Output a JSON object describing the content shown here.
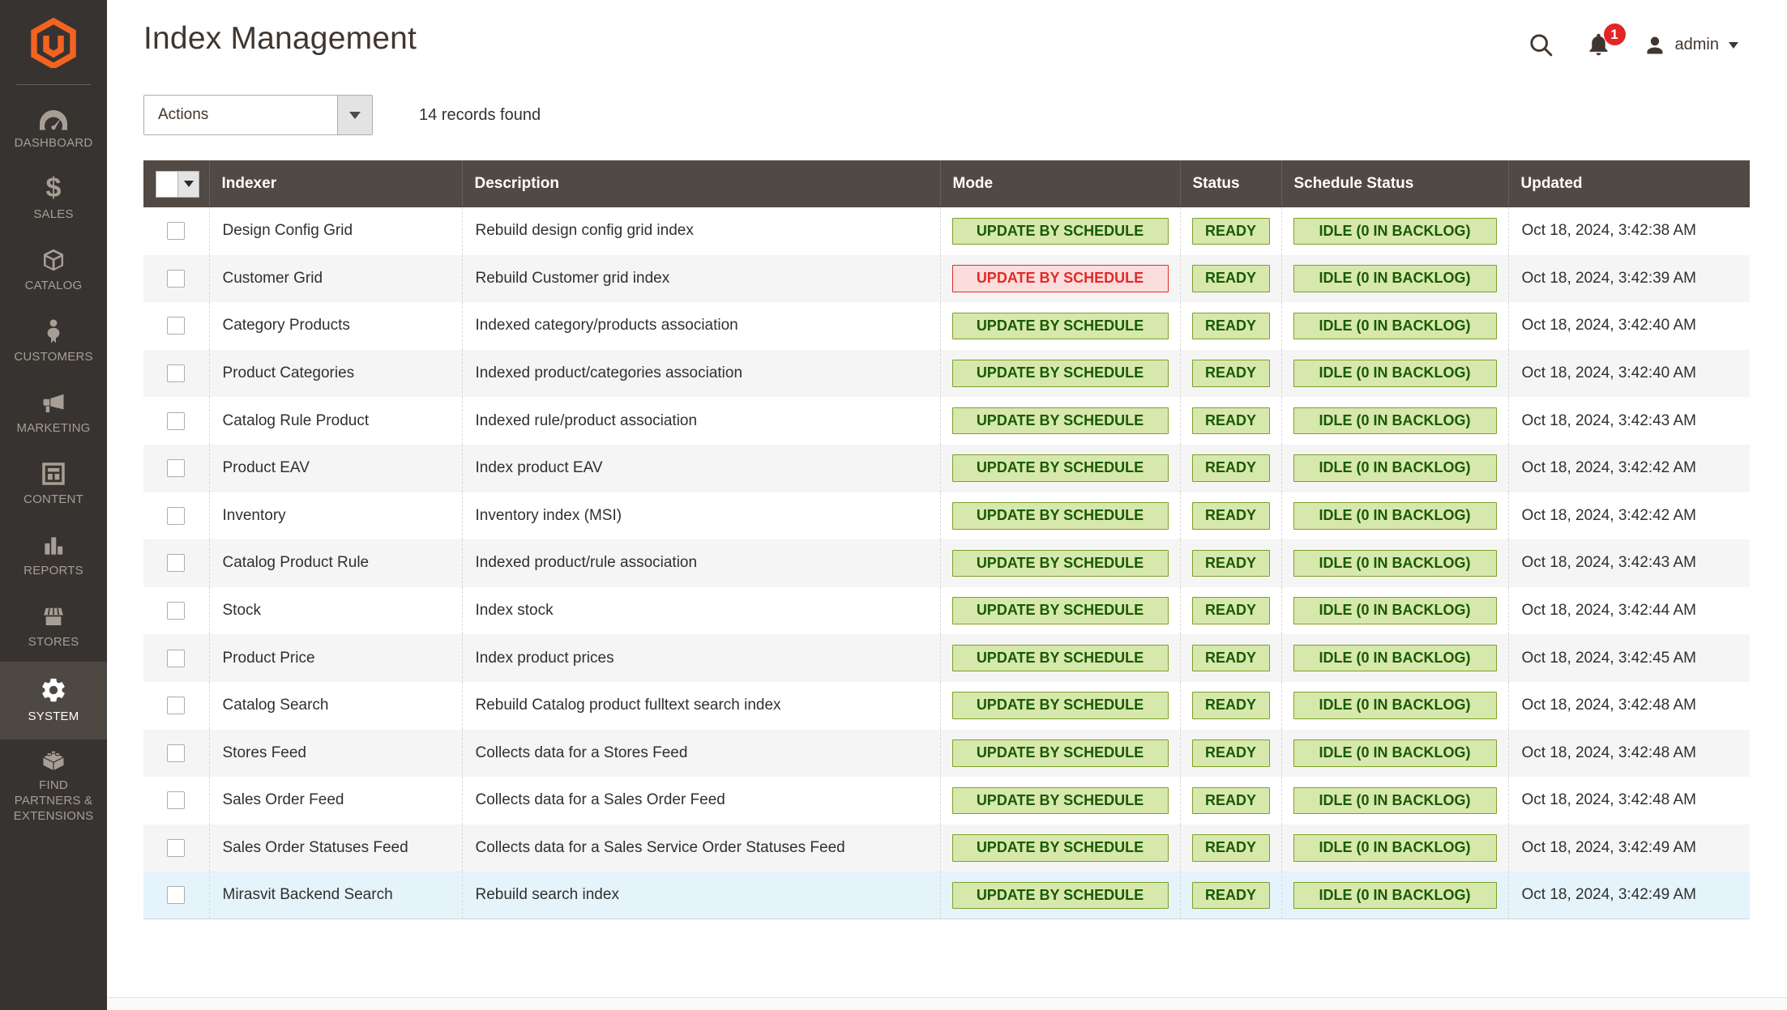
{
  "header": {
    "title": "Index Management",
    "user": "admin",
    "notification_count": "1"
  },
  "sidebar": {
    "items": [
      {
        "label": "DASHBOARD",
        "icon": "dashboard-icon",
        "active": false
      },
      {
        "label": "SALES",
        "icon": "sales-icon",
        "active": false
      },
      {
        "label": "CATALOG",
        "icon": "catalog-icon",
        "active": false
      },
      {
        "label": "CUSTOMERS",
        "icon": "customers-icon",
        "active": false
      },
      {
        "label": "MARKETING",
        "icon": "marketing-icon",
        "active": false
      },
      {
        "label": "CONTENT",
        "icon": "content-icon",
        "active": false
      },
      {
        "label": "REPORTS",
        "icon": "reports-icon",
        "active": false
      },
      {
        "label": "STORES",
        "icon": "stores-icon",
        "active": false
      },
      {
        "label": "SYSTEM",
        "icon": "system-icon",
        "active": true
      },
      {
        "label": "FIND PARTNERS & EXTENSIONS",
        "icon": "partners-icon",
        "active": false,
        "tall": true
      }
    ]
  },
  "toolbar": {
    "actions_label": "Actions",
    "records_found": "14 records found"
  },
  "table": {
    "columns": [
      "Indexer",
      "Description",
      "Mode",
      "Status",
      "Schedule Status",
      "Updated"
    ],
    "rows": [
      {
        "indexer": "Design Config Grid",
        "description": "Rebuild design config grid index",
        "mode": "UPDATE BY SCHEDULE",
        "mode_severity": "notice",
        "status": "READY",
        "schedule_status": "IDLE (0 IN BACKLOG)",
        "updated": "Oct 18, 2024, 3:42:38 AM",
        "highlight": false
      },
      {
        "indexer": "Customer Grid",
        "description": "Rebuild Customer grid index",
        "mode": "UPDATE BY SCHEDULE",
        "mode_severity": "critical",
        "status": "READY",
        "schedule_status": "IDLE (0 IN BACKLOG)",
        "updated": "Oct 18, 2024, 3:42:39 AM",
        "highlight": false
      },
      {
        "indexer": "Category Products",
        "description": "Indexed category/products association",
        "mode": "UPDATE BY SCHEDULE",
        "mode_severity": "notice",
        "status": "READY",
        "schedule_status": "IDLE (0 IN BACKLOG)",
        "updated": "Oct 18, 2024, 3:42:40 AM",
        "highlight": false
      },
      {
        "indexer": "Product Categories",
        "description": "Indexed product/categories association",
        "mode": "UPDATE BY SCHEDULE",
        "mode_severity": "notice",
        "status": "READY",
        "schedule_status": "IDLE (0 IN BACKLOG)",
        "updated": "Oct 18, 2024, 3:42:40 AM",
        "highlight": false
      },
      {
        "indexer": "Catalog Rule Product",
        "description": "Indexed rule/product association",
        "mode": "UPDATE BY SCHEDULE",
        "mode_severity": "notice",
        "status": "READY",
        "schedule_status": "IDLE (0 IN BACKLOG)",
        "updated": "Oct 18, 2024, 3:42:43 AM",
        "highlight": false
      },
      {
        "indexer": "Product EAV",
        "description": "Index product EAV",
        "mode": "UPDATE BY SCHEDULE",
        "mode_severity": "notice",
        "status": "READY",
        "schedule_status": "IDLE (0 IN BACKLOG)",
        "updated": "Oct 18, 2024, 3:42:42 AM",
        "highlight": false
      },
      {
        "indexer": "Inventory",
        "description": "Inventory index (MSI)",
        "mode": "UPDATE BY SCHEDULE",
        "mode_severity": "notice",
        "status": "READY",
        "schedule_status": "IDLE (0 IN BACKLOG)",
        "updated": "Oct 18, 2024, 3:42:42 AM",
        "highlight": false
      },
      {
        "indexer": "Catalog Product Rule",
        "description": "Indexed product/rule association",
        "mode": "UPDATE BY SCHEDULE",
        "mode_severity": "notice",
        "status": "READY",
        "schedule_status": "IDLE (0 IN BACKLOG)",
        "updated": "Oct 18, 2024, 3:42:43 AM",
        "highlight": false
      },
      {
        "indexer": "Stock",
        "description": "Index stock",
        "mode": "UPDATE BY SCHEDULE",
        "mode_severity": "notice",
        "status": "READY",
        "schedule_status": "IDLE (0 IN BACKLOG)",
        "updated": "Oct 18, 2024, 3:42:44 AM",
        "highlight": false
      },
      {
        "indexer": "Product Price",
        "description": "Index product prices",
        "mode": "UPDATE BY SCHEDULE",
        "mode_severity": "notice",
        "status": "READY",
        "schedule_status": "IDLE (0 IN BACKLOG)",
        "updated": "Oct 18, 2024, 3:42:45 AM",
        "highlight": false
      },
      {
        "indexer": "Catalog Search",
        "description": "Rebuild Catalog product fulltext search index",
        "mode": "UPDATE BY SCHEDULE",
        "mode_severity": "notice",
        "status": "READY",
        "schedule_status": "IDLE (0 IN BACKLOG)",
        "updated": "Oct 18, 2024, 3:42:48 AM",
        "highlight": false
      },
      {
        "indexer": "Stores Feed",
        "description": "Collects data for a Stores Feed",
        "mode": "UPDATE BY SCHEDULE",
        "mode_severity": "notice",
        "status": "READY",
        "schedule_status": "IDLE (0 IN BACKLOG)",
        "updated": "Oct 18, 2024, 3:42:48 AM",
        "highlight": false
      },
      {
        "indexer": "Sales Order Feed",
        "description": "Collects data for a Sales Order Feed",
        "mode": "UPDATE BY SCHEDULE",
        "mode_severity": "notice",
        "status": "READY",
        "schedule_status": "IDLE (0 IN BACKLOG)",
        "updated": "Oct 18, 2024, 3:42:48 AM",
        "highlight": false
      },
      {
        "indexer": "Sales Order Statuses Feed",
        "description": "Collects data for a Sales Service Order Statuses Feed",
        "mode": "UPDATE BY SCHEDULE",
        "mode_severity": "notice",
        "status": "READY",
        "schedule_status": "IDLE (0 IN BACKLOG)",
        "updated": "Oct 18, 2024, 3:42:49 AM",
        "highlight": false
      },
      {
        "indexer": "Mirasvit Backend Search",
        "description": "Rebuild search index",
        "mode": "UPDATE BY SCHEDULE",
        "mode_severity": "notice",
        "status": "READY",
        "schedule_status": "IDLE (0 IN BACKLOG)",
        "updated": "Oct 18, 2024, 3:42:49 AM",
        "highlight": true
      }
    ]
  },
  "colors": {
    "brand_orange": "#f26322",
    "sidebar_bg": "#373330",
    "sidebar_active_bg": "#4e4843",
    "table_header_bg": "#514943",
    "badge_notice_bg": "#d7e8ad",
    "badge_notice_border": "#7ca028",
    "badge_notice_text": "#185b00",
    "badge_critical_bg": "#fbdddd",
    "badge_critical_text": "#e02b27",
    "row_alt_bg": "#f5f5f5",
    "row_highlight_bg": "#e5f3fb",
    "notification_badge": "#e22626"
  }
}
